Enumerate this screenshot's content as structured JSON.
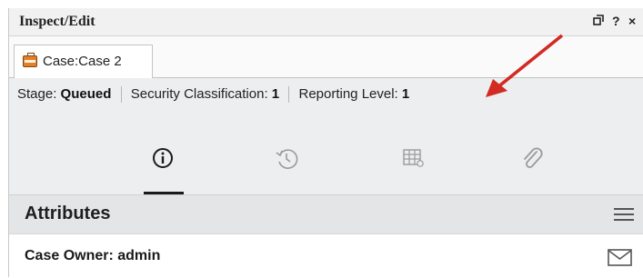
{
  "window": {
    "title": "Inspect/Edit",
    "controls": {
      "restore_icon": "restore-window-icon",
      "help_label": "?",
      "close_label": "×"
    }
  },
  "tab": {
    "label": "Case:Case 2",
    "icon": "briefcase-icon"
  },
  "meta": {
    "stage_label": "Stage: ",
    "stage_value": "Queued",
    "security_label": "Security Classification: ",
    "security_value": "1",
    "reporting_label": "Reporting Level: ",
    "reporting_value": "1"
  },
  "toolbar": {
    "icons": [
      "info-icon",
      "history-icon",
      "table-grid-icon",
      "attachment-icon"
    ],
    "active": "info-icon"
  },
  "attributes": {
    "title": "Attributes",
    "menu_icon": "hamburger-menu-icon"
  },
  "owner": {
    "text": "Case Owner: admin",
    "mail_icon": "mail-icon"
  },
  "annotation": {
    "arrow_color": "#d32a23"
  },
  "colors": {
    "accent_tab_icon": "#e67e22",
    "panel_bg": "#eceeef"
  }
}
